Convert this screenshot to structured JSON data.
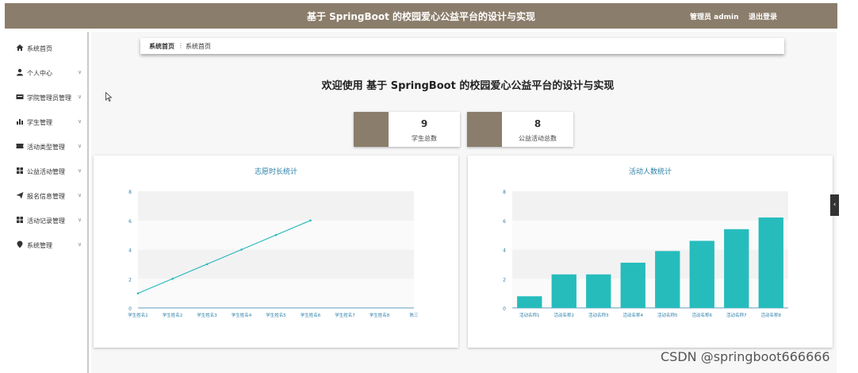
{
  "header": {
    "title": "基于 SpringBoot 的校园爱心公益平台的设计与实现",
    "admin": "管理员 admin",
    "logout": "退出登录"
  },
  "sidebar": {
    "items": [
      {
        "label": "系统首页",
        "icon": "home-icon"
      },
      {
        "label": "个人中心",
        "icon": "user-icon"
      },
      {
        "label": "学院管理员管理",
        "icon": "card-icon"
      },
      {
        "label": "学生管理",
        "icon": "bar-chart-icon"
      },
      {
        "label": "活动类型管理",
        "icon": "ticket-icon"
      },
      {
        "label": "公益活动管理",
        "icon": "grid-icon"
      },
      {
        "label": "报名信息管理",
        "icon": "send-icon"
      },
      {
        "label": "活动记录管理",
        "icon": "grid-icon"
      },
      {
        "label": "系统管理",
        "icon": "pin-icon"
      }
    ]
  },
  "breadcrumb": {
    "first": "系统首页",
    "separator": "⋮",
    "current": "系统首页"
  },
  "welcome": "欢迎使用 基于 SpringBoot 的校园爱心公益平台的设计与实现",
  "stats": [
    {
      "value": "9",
      "label": "学生总数"
    },
    {
      "value": "8",
      "label": "公益活动总数"
    }
  ],
  "chart_data": [
    {
      "type": "line",
      "title": "志愿时长统计",
      "categories": [
        "学生姓名1",
        "学生姓名2",
        "学生姓名3",
        "学生姓名4",
        "学生姓名5",
        "学生姓名6",
        "学生姓名7",
        "学生姓名8",
        "陈三"
      ],
      "values": [
        1,
        2,
        3,
        4,
        5,
        6
      ],
      "ylim": [
        0,
        8
      ],
      "yticks": [
        "0",
        "2",
        "4",
        "6",
        "8"
      ],
      "color": "#26b7bc"
    },
    {
      "type": "bar",
      "title": "活动人数统计",
      "categories": [
        "活动名称1",
        "活动名称2",
        "活动名称3",
        "活动名称4",
        "活动名称5",
        "活动名称6",
        "活动名称7",
        "活动名称8"
      ],
      "values": [
        0.8,
        2.3,
        2.3,
        3.1,
        3.9,
        4.6,
        5.4,
        6.2
      ],
      "ylim": [
        0,
        8
      ],
      "yticks": [
        "0",
        "2",
        "4",
        "6",
        "8"
      ],
      "color": "#26bcbc"
    }
  ],
  "side_tab": "‹",
  "watermark": "CSDN @springboot666666",
  "colors": {
    "header": "#8b7d6b",
    "accent": "#26b7bc"
  }
}
